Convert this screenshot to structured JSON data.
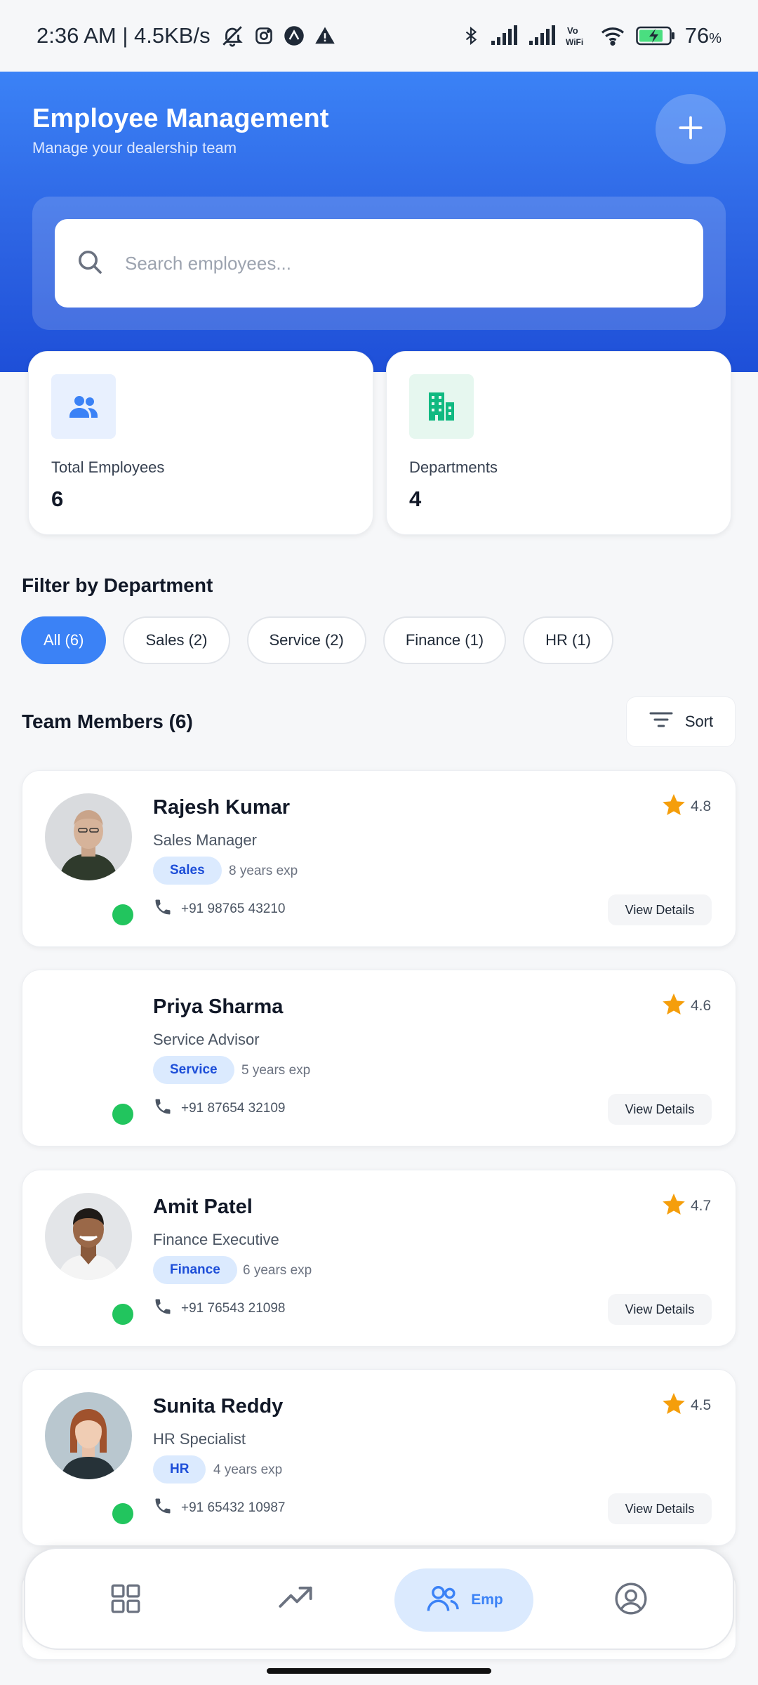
{
  "status_bar": {
    "time": "2:36 AM | 4.5KB/s",
    "battery": "76",
    "battery_unit": "%"
  },
  "header": {
    "title": "Employee Management",
    "subtitle": "Manage your dealership team",
    "add_icon": "plus-icon"
  },
  "search": {
    "placeholder": "Search employees...",
    "value": ""
  },
  "stats": [
    {
      "label": "Total Employees",
      "value": "6",
      "icon": "people-icon",
      "color": "#3b82f6",
      "bg": "#e8f0fe"
    },
    {
      "label": "Departments",
      "value": "4",
      "icon": "building-icon",
      "color": "#10b981",
      "bg": "#e6f7ef"
    }
  ],
  "filter": {
    "title": "Filter by Department",
    "chips": [
      {
        "label": "All (6)",
        "active": true
      },
      {
        "label": "Sales (2)",
        "active": false
      },
      {
        "label": "Service (2)",
        "active": false
      },
      {
        "label": "Finance (1)",
        "active": false
      },
      {
        "label": "HR (1)",
        "active": false
      }
    ]
  },
  "team": {
    "title": "Team Members (6)",
    "sort_label": "Sort"
  },
  "employees": [
    {
      "name": "Rajesh Kumar",
      "role": "Sales Manager",
      "department": "Sales",
      "experience": "8 years exp",
      "phone": "+91 98765 43210",
      "rating": "4.8",
      "view_label": "View Details"
    },
    {
      "name": "Priya Sharma",
      "role": "Service Advisor",
      "department": "Service",
      "experience": "5 years exp",
      "phone": "+91 87654 32109",
      "rating": "4.6",
      "view_label": "View Details"
    },
    {
      "name": "Amit Patel",
      "role": "Finance Executive",
      "department": "Finance",
      "experience": "6 years exp",
      "phone": "+91 76543 21098",
      "rating": "4.7",
      "view_label": "View Details"
    },
    {
      "name": "Sunita Reddy",
      "role": "HR Specialist",
      "department": "HR",
      "experience": "4 years exp",
      "phone": "+91 65432 10987",
      "rating": "4.5",
      "view_label": "View Details"
    }
  ],
  "colors": {
    "accent": "#3b82f6",
    "online": "#22c55e",
    "star": "#f59e0b",
    "badge_bg": "#dbeafe",
    "badge_text": "#1d4ed8"
  },
  "bottom_nav": {
    "items": [
      {
        "icon": "grid-icon",
        "label": ""
      },
      {
        "icon": "trending-up-icon",
        "label": ""
      },
      {
        "icon": "people-icon",
        "label": "Emp",
        "active": true
      },
      {
        "icon": "profile-icon",
        "label": ""
      }
    ]
  }
}
